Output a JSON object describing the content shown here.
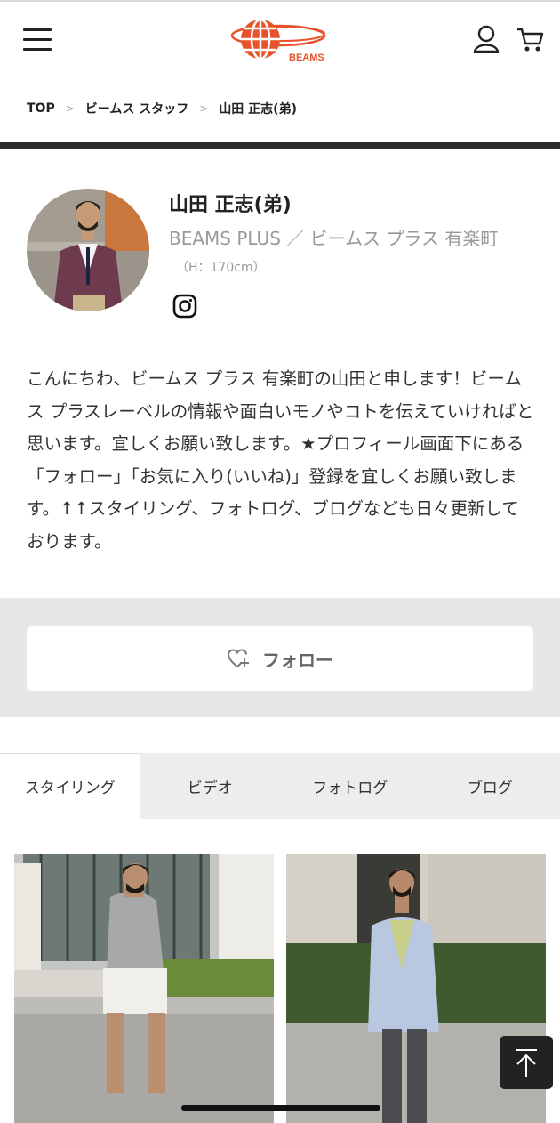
{
  "header": {
    "logo_text": "BEAMS",
    "menu_icon": "hamburger-menu-icon",
    "user_icon": "user-icon",
    "cart_icon": "cart-icon"
  },
  "breadcrumb": {
    "items": [
      "TOP",
      "ビームス スタッフ",
      "山田 正志(弟)"
    ],
    "separator": ">"
  },
  "profile": {
    "name": "山田 正志(弟)",
    "shop": "BEAMS PLUS ／ ビームス プラス 有楽町",
    "height": "（H：170cm）",
    "social_icon": "instagram-icon",
    "bio": "こんにちわ、ビームス プラス 有楽町の山田と申します！ビームス プラスレーベルの情報や面白いモノやコトを伝えていければと思います。宜しくお願い致します。★プロフィール画面下にある「フォロー」「お気に入り(いいね)」登録を宜しくお願い致します。↑↑スタイリング、フォトログ、ブログなども日々更新しております。"
  },
  "follow": {
    "label": "フォロー",
    "icon": "heart-plus-icon"
  },
  "tabs": [
    {
      "label": "スタイリング",
      "active": true
    },
    {
      "label": "ビデオ",
      "active": false
    },
    {
      "label": "フォトログ",
      "active": false
    },
    {
      "label": "ブログ",
      "active": false
    }
  ],
  "colors": {
    "brand": "#e8522a",
    "divider": "#2b2b2b",
    "band": "#e7e7e7"
  },
  "back_to_top_icon": "arrow-up-to-top-icon"
}
